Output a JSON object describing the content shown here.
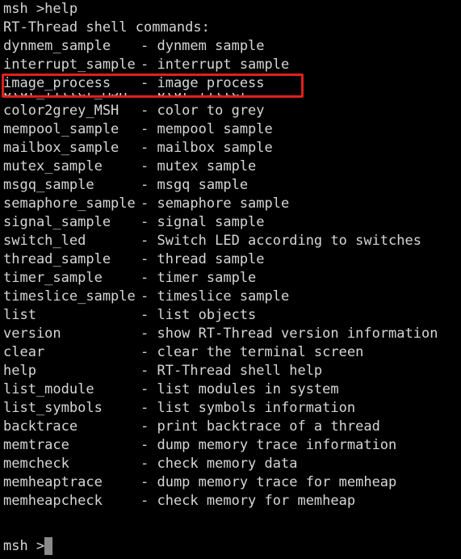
{
  "terminal": {
    "header": "msh >help",
    "subheader": "RT-Thread shell commands:",
    "commands": [
      {
        "name": "dynmem_sample",
        "desc": "- dynmem sample"
      },
      {
        "name": "interrupt_sample",
        "desc": "- interrupt sample"
      },
      {
        "name": "image_process",
        "desc": "- image process"
      },
      {
        "name": "blur_filter_MSH",
        "desc": "- blur filter"
      },
      {
        "name": "color2grey_MSH",
        "desc": "- color to grey"
      },
      {
        "name": "mempool_sample",
        "desc": "- mempool sample"
      },
      {
        "name": "mailbox_sample",
        "desc": "- mailbox sample"
      },
      {
        "name": "mutex_sample",
        "desc": "- mutex sample"
      },
      {
        "name": "msgq_sample",
        "desc": "- msgq sample"
      },
      {
        "name": "semaphore_sample",
        "desc": "- semaphore sample"
      },
      {
        "name": "signal_sample",
        "desc": "- signal sample"
      },
      {
        "name": "switch_led",
        "desc": "- Switch LED according to switches"
      },
      {
        "name": "thread_sample",
        "desc": "- thread sample"
      },
      {
        "name": "timer_sample",
        "desc": "- timer sample"
      },
      {
        "name": "timeslice_sample",
        "desc": "- timeslice sample"
      },
      {
        "name": "list",
        "desc": "- list objects"
      },
      {
        "name": "version",
        "desc": "- show RT-Thread version information"
      },
      {
        "name": "clear",
        "desc": "- clear the terminal screen"
      },
      {
        "name": "help",
        "desc": "- RT-Thread shell help"
      },
      {
        "name": "list_module",
        "desc": "- list modules in system"
      },
      {
        "name": "list_symbols",
        "desc": "- list symbols information"
      },
      {
        "name": "backtrace",
        "desc": "- print backtrace of a thread"
      },
      {
        "name": "memtrace",
        "desc": "- dump memory trace information"
      },
      {
        "name": "memcheck",
        "desc": "- check memory data"
      },
      {
        "name": "memheaptrace",
        "desc": "- dump memory trace for memheap"
      },
      {
        "name": "memheapcheck",
        "desc": "- check memory for memheap"
      }
    ],
    "prompt": "msh >"
  },
  "colors": {
    "background": "#000000",
    "text": "#d6d6d6",
    "highlight_border": "#e0201c",
    "cursor": "#8a8a8a"
  }
}
